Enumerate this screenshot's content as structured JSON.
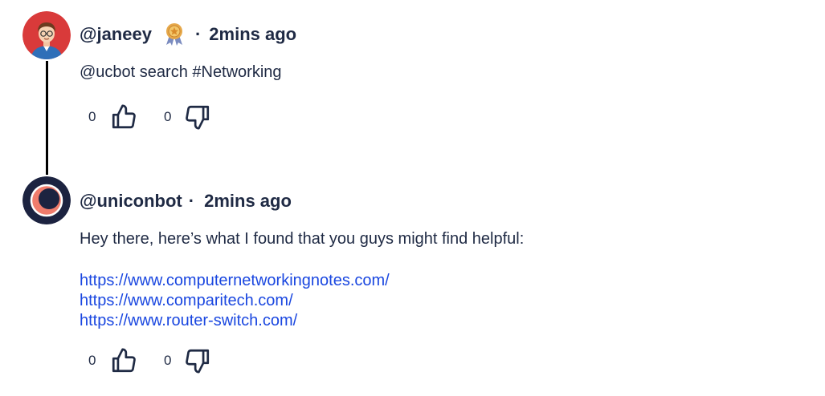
{
  "comments": [
    {
      "username": "@janeey",
      "separator": "·",
      "time": "2mins ago",
      "badge_icon": "award-ribbon-icon",
      "text": "@ucbot search #Networking",
      "likes": "0",
      "dislikes": "0"
    },
    {
      "username": "@uniconbot",
      "separator": "·",
      "time": "2mins ago",
      "text": "Hey there, here’s what I found that you guys might find helpful:",
      "links": [
        "https://www.computernetworkingnotes.com/",
        "https://www.comparitech.com/",
        "https://www.router-switch.com/"
      ],
      "likes": "0",
      "dislikes": "0"
    }
  ],
  "colors": {
    "text": "#1f2a44",
    "link": "#1a47e0",
    "avatar_red": "#d93a3a",
    "bot_navy": "#1c2340",
    "bot_salmon": "#f07c6c",
    "badge_gold": "#e6a84a"
  }
}
